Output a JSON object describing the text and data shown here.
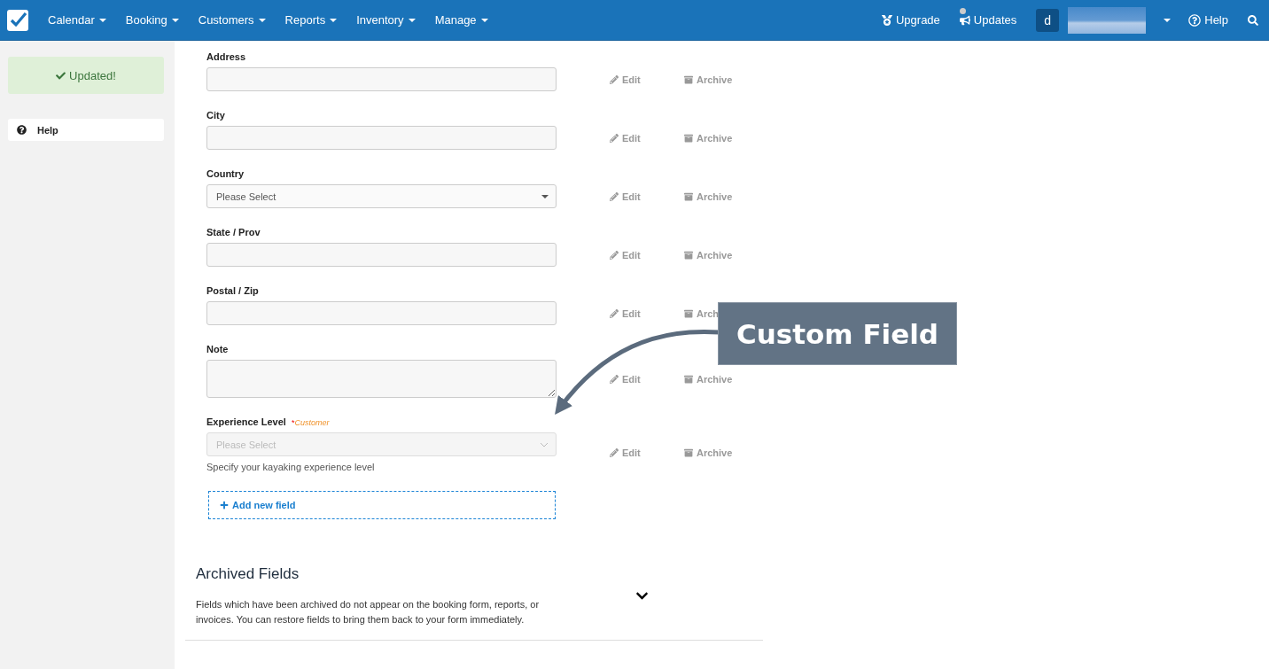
{
  "navbar": {
    "menus": [
      {
        "label": "Calendar"
      },
      {
        "label": "Booking"
      },
      {
        "label": "Customers"
      },
      {
        "label": "Reports"
      },
      {
        "label": "Inventory"
      },
      {
        "label": "Manage"
      }
    ],
    "upgrade": "Upgrade",
    "updates": "Updates",
    "avatar": "d",
    "help": "Help"
  },
  "sidebar": {
    "alert": "Updated!",
    "help": "Help"
  },
  "fields": [
    {
      "kind": "text",
      "label": "Address",
      "edit": "Edit",
      "archive": "Archive"
    },
    {
      "kind": "text",
      "label": "City",
      "edit": "Edit",
      "archive": "Archive"
    },
    {
      "kind": "select",
      "label": "Country",
      "placeholder": "Please Select",
      "disabled": false,
      "edit": "Edit",
      "archive": "Archive"
    },
    {
      "kind": "text",
      "label": "State / Prov",
      "edit": "Edit",
      "archive": "Archive"
    },
    {
      "kind": "text",
      "label": "Postal / Zip",
      "edit": "Edit",
      "archive": "Arch"
    },
    {
      "kind": "textarea",
      "label": "Note",
      "edit": "Edit",
      "archive": "Archive"
    },
    {
      "kind": "select",
      "label": "Experience Level",
      "required_mark": "*",
      "tag": "Customer",
      "placeholder": "Please Select",
      "disabled": true,
      "hint": "Specify your kayaking experience level",
      "edit": "Edit",
      "archive": "Archive"
    }
  ],
  "add_field": "Add new field",
  "archived": {
    "title": "Archived Fields",
    "description": "Fields which have been archived do not appear on the booking form, reports, or invoices. You can restore fields to bring them back to your form immediately.",
    "expanded": false
  },
  "callout": {
    "text": "Custom Field"
  }
}
